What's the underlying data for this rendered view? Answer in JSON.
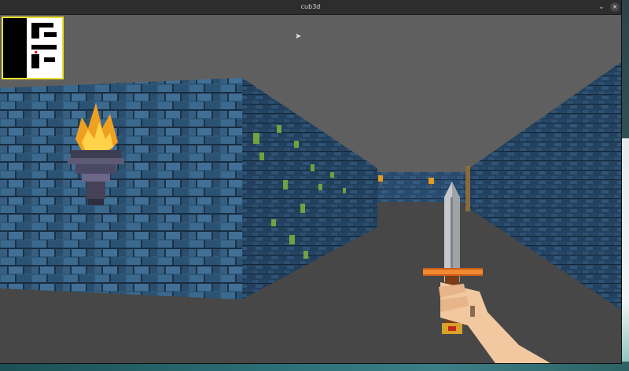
{
  "window": {
    "title": "cub3d",
    "minimize_glyph": "⌄",
    "close_glyph": "×"
  },
  "scene": {
    "ceiling_color": "#5f5f5f",
    "floor_color": "#474747",
    "wall_color": "#2f5878",
    "torch_icon": "torch-icon",
    "weapon_icon": "sword-icon"
  },
  "minimap": {
    "border_color": "#f2e02c",
    "wall_color": "#ffffff",
    "floor_color": "#000000",
    "player_color": "#ff0000"
  }
}
